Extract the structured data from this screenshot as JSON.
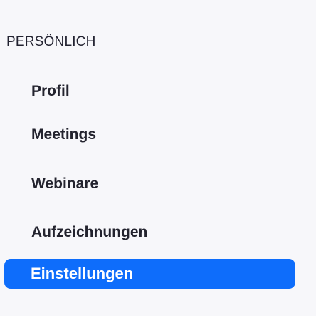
{
  "sidebar": {
    "section_title": "PERSÖNLICH",
    "items": [
      {
        "label": "Profil",
        "active": false
      },
      {
        "label": "Meetings",
        "active": false
      },
      {
        "label": "Webinare",
        "active": false
      },
      {
        "label": "Aufzeichnungen",
        "active": false
      },
      {
        "label": "Einstellungen",
        "active": true
      }
    ],
    "accent_color": "#0e6dfb",
    "background_color": "#f7f7fa",
    "text_color": "#23232e"
  }
}
